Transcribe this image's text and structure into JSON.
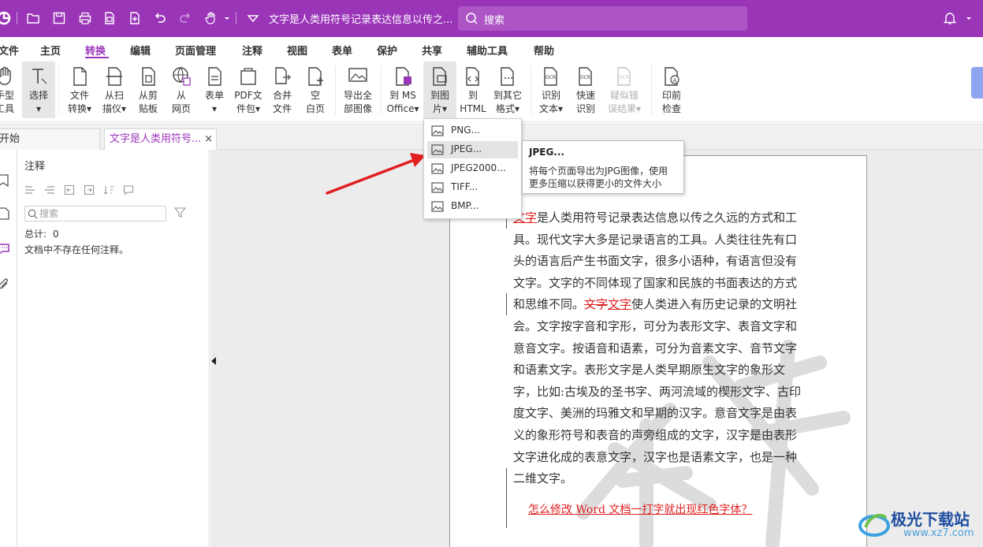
{
  "colors": {
    "brand": "#9b35b8",
    "accent_red": "#e02020"
  },
  "titlebar": {
    "doc_title": "文字是人类用符号记录表达信息以传之...",
    "search_label": "搜索",
    "icons": [
      "app-logo-icon",
      "open-folder-icon",
      "save-icon",
      "print-icon",
      "new-doc-icon",
      "new-doc-plus-icon",
      "undo-icon",
      "redo-icon",
      "hand-icon",
      "dropdown-icon",
      "bell-icon"
    ]
  },
  "menu": {
    "items": [
      "文件",
      "主页",
      "转换",
      "编辑",
      "页面管理",
      "注释",
      "视图",
      "表单",
      "保护",
      "共享",
      "辅助工具",
      "帮助"
    ],
    "active": "转换"
  },
  "ribbon": {
    "buttons": [
      {
        "label": "手型\n工具"
      },
      {
        "label": "选择\n▾"
      },
      {
        "label": "文件\n转换▾"
      },
      {
        "label": "从扫\n描仪▾"
      },
      {
        "label": "从剪\n贴板"
      },
      {
        "label": "从\n网页"
      },
      {
        "label": "表单\n▾"
      },
      {
        "label": "PDF文\n件包▾"
      },
      {
        "label": "合并\n文件"
      },
      {
        "label": "空\n白页"
      },
      {
        "label": "导出全\n部图像"
      },
      {
        "label": "到 MS\nOffice▾"
      },
      {
        "label": "到图\n片▾"
      },
      {
        "label": "到\nHTML"
      },
      {
        "label": "到其它\n格式▾"
      },
      {
        "label": "识别\n文本▾"
      },
      {
        "label": "快速\n识别"
      },
      {
        "label": "疑似错\n误结果▾"
      },
      {
        "label": "印前\n检查"
      }
    ]
  },
  "tabs": [
    {
      "label": "开始"
    },
    {
      "label": "文字是人类用符号...",
      "close": "×"
    }
  ],
  "anno_panel": {
    "title": "注释",
    "search_placeholder": "搜索",
    "total_label": "总计:",
    "total_count": "0",
    "empty_message": "文档中不存在任何注释。"
  },
  "dropdown": {
    "items": [
      "PNG...",
      "JPEG...",
      "JPEG2000...",
      "TIFF...",
      "BMP..."
    ],
    "hovered": "JPEG..."
  },
  "tooltip": {
    "title": "JPEG...",
    "description": "将每个页面导出为JPG图像，使用更多压缩以获得更小的文件大小"
  },
  "document": {
    "para1_red_prefix": "文字",
    "para1_rest": "是人类用符号记录表达信息以传之久远的方式和工具。现代文字大多是记录语言的工具。人类往往先有口头的语言后产生书面文字，很多小语种，有语言但没有文字。文字的不同体现了国家和民族的书面表达的方式和思维不同。",
    "strike_text": "文字",
    "inserted_text": "文字",
    "para1_tail": "使人类进入有历史记录的文明社会。文字按字音和字形，可分为表形文字、表音文字和意音文字。按语音和语素，可分为音素文字、音节文字和语素文字。表形文字是人类早期原生文字的象形文字，比如:古埃及的圣书字、两河流域的楔形文字、古印度文字、美洲的玛雅文和早期的汉字。意音文字是由表义的象形符号和表音的声旁组成的文字，汉字是由表形文字进化成的表意文字，汉字也是语素文字，也是一种二维文字。",
    "link": "怎么修改 Word 文档一打字就出现红色字体？",
    "watermark_lettering": "保密"
  },
  "brand": {
    "name": "极光下载站",
    "url": "www.xz7.com"
  }
}
